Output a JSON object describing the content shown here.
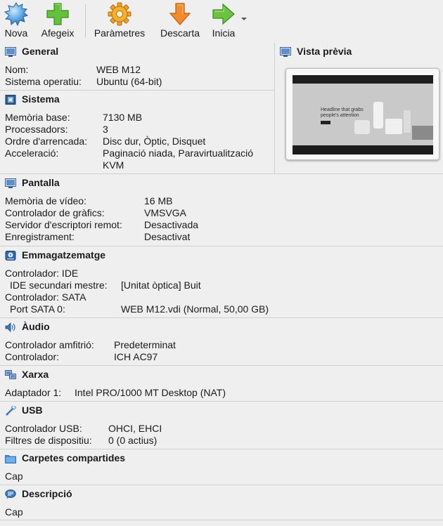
{
  "toolbar": {
    "new_label": "Nova",
    "add_label": "Afegeix",
    "settings_label": "Paràmetres",
    "discard_label": "Descarta",
    "start_label": "Inicia"
  },
  "general": {
    "title": "General",
    "name_key": "Nom:",
    "name_val": "WEB M12",
    "os_key": "Sistema operatiu:",
    "os_val": "Ubuntu (64-bit)"
  },
  "system": {
    "title": "Sistema",
    "mem_key": "Memòria base:",
    "mem_val": "7130 MB",
    "cpu_key": "Processadors:",
    "cpu_val": "3",
    "boot_key": "Ordre d'arrencada:",
    "boot_val": "Disc dur, Òptic, Disquet",
    "accel_key": "Acceleració:",
    "accel_val1": "Paginació niada, Paravirtualització",
    "accel_val2": "KVM"
  },
  "preview": {
    "title": "Vista prèvia",
    "headline1": "Headline that grabs",
    "headline2": "people's attention"
  },
  "display": {
    "title": "Pantalla",
    "vmem_key": "Memòria de vídeo:",
    "vmem_val": "16 MB",
    "gfx_key": "Controlador de gràfics:",
    "gfx_val": "VMSVGA",
    "rdp_key": "Servidor d'escriptori remot:",
    "rdp_val": "Desactivada",
    "rec_key": "Enregistrament:",
    "rec_val": "Desactivat"
  },
  "storage": {
    "title": "Emmagatzematge",
    "ctrl_ide": "Controlador: IDE",
    "ide_key": "IDE secundari mestre:",
    "ide_val": "[Unitat òptica] Buit",
    "ctrl_sata": "Controlador: SATA",
    "sata_key": "Port SATA 0:",
    "sata_val": "WEB M12.vdi (Normal, 50,00 GB)"
  },
  "audio": {
    "title": "Àudio",
    "host_key": "Controlador amfitrió:",
    "host_val": "Predeterminat",
    "ctrl_key": "Controlador:",
    "ctrl_val": "ICH AC97"
  },
  "network": {
    "title": "Xarxa",
    "adapter_key": "Adaptador 1:",
    "adapter_val": "Intel PRO/1000 MT Desktop (NAT)"
  },
  "usb": {
    "title": "USB",
    "ctrl_key": "Controlador USB:",
    "ctrl_val": "OHCI, EHCI",
    "filter_key": "Filtres de dispositiu:",
    "filter_val": "0 (0 actius)"
  },
  "shared": {
    "title": "Carpetes compartides",
    "value": "Cap"
  },
  "description": {
    "title": "Descripció",
    "value": "Cap"
  }
}
